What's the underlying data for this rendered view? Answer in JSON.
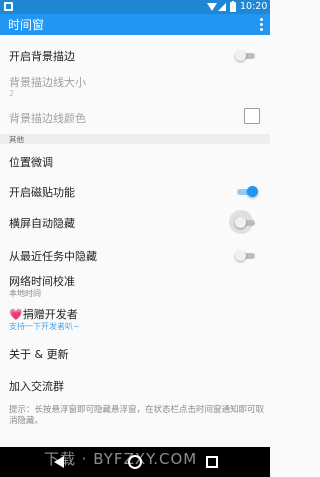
{
  "status_bar": {
    "time": "10:20"
  },
  "app_bar": {
    "title": "时间窗"
  },
  "settings": {
    "bg_stroke": {
      "label": "开启背景描边",
      "enabled": false
    },
    "stroke_width": {
      "label": "背景描边线大小",
      "value": "2"
    },
    "stroke_color": {
      "label": "背景描边线颜色",
      "checked": false
    },
    "category_other": "其他",
    "position_tweak": {
      "label": "位置微调"
    },
    "magnet": {
      "label": "开启磁贴功能",
      "enabled": true
    },
    "landscape_hide": {
      "label": "横屏自动隐藏",
      "enabled": false
    },
    "recents_hide": {
      "label": "从最近任务中隐藏",
      "enabled": false
    },
    "network_time": {
      "label": "网络时间校准",
      "value": "本地时间"
    },
    "donate": {
      "heart": "💗",
      "label": "捐赠开发者",
      "sub": "支持一下开发者叭~"
    },
    "about": {
      "label": "关于 & 更新"
    },
    "join_group": {
      "label": "加入交流群"
    },
    "hint": "提示：长按悬浮窗即可隐藏悬浮窗，在状态栏点击时间窗通知即可取消隐藏。"
  },
  "watermark": "下载 · BYFZXY.COM"
}
